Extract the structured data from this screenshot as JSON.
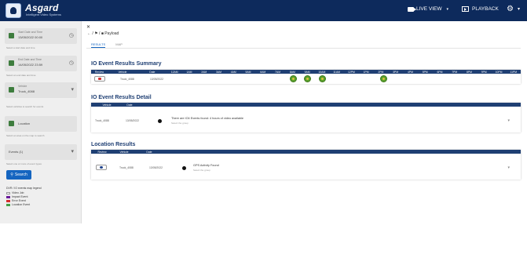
{
  "topbar": {
    "brand": "Asgard",
    "tagline": "Intelligent Video Systems",
    "liveview_label": "LIVE VIEW",
    "playback_label": "PLAYBACK",
    "caret": "▾",
    "gear_icon": "gear-icon"
  },
  "sidebar": {
    "start": {
      "label": "Start Date and Time",
      "value": "13/05/2022 00:00"
    },
    "start_hint": "Select a start date and time",
    "end": {
      "label": "End Date and Time",
      "value": "14/05/2022 23:59"
    },
    "end_hint": "Select an end date and time",
    "vehicle": {
      "label": "Vehicle",
      "value": "Truck_4088"
    },
    "vehicle_hint": "Select vehicles to search for events",
    "location": {
      "value": "Location"
    },
    "location_hint": "Select an area on the map to search",
    "events": {
      "value": "Events (1)"
    },
    "events_hint": "Select one or more of event types",
    "search_label": "Search",
    "legend_title": "DVR / IO events map legend",
    "legend": [
      {
        "label": "Video Job",
        "color": "#ffffff"
      },
      {
        "label": "Impact Event",
        "color": "#6a1b9a"
      },
      {
        "label": "Error Event",
        "color": "#d32f2f"
      },
      {
        "label": "Location Event",
        "color": "#43a047"
      }
    ]
  },
  "breadcrumb": "← / ⚑ / ■ Payload",
  "tabs": [
    "RESULTS",
    "MAP"
  ],
  "summary": {
    "title": "IO Event Results Summary",
    "headers": [
      "Review",
      "Vehicle",
      "Date",
      "12AM",
      "1AM",
      "2AM",
      "3AM",
      "4AM",
      "5AM",
      "6AM",
      "7AM",
      "8AM",
      "9AM",
      "10AM",
      "11AM",
      "12PM",
      "1PM",
      "2PM",
      "3PM",
      "4PM",
      "5PM",
      "6PM",
      "7PM",
      "8PM",
      "9PM",
      "10PM",
      "11PM"
    ],
    "row": {
      "vehicle": "Truck_4088",
      "date": "13/05/2022"
    }
  },
  "detail": {
    "title": "IO Event Results Detail",
    "headers": [
      "Vehicle",
      "Date"
    ],
    "row": {
      "vehicle": "Truck_4088",
      "date": "13/05/2022",
      "message": "There are IO4 Events found: 4 hours of video available",
      "sub": "Select the group"
    }
  },
  "location": {
    "title": "Location Results",
    "headers": [
      "Review",
      "Vehicle",
      "Date"
    ],
    "row": {
      "vehicle": "Truck_4088",
      "date": "13/05/2022",
      "message": "GPS Activity Found",
      "sub": "Select the group"
    }
  },
  "colors": {
    "nav": "#0d2a5c",
    "table_header": "#1f3f73",
    "accent": "#1565c0",
    "event_green": "#5aa02c"
  }
}
